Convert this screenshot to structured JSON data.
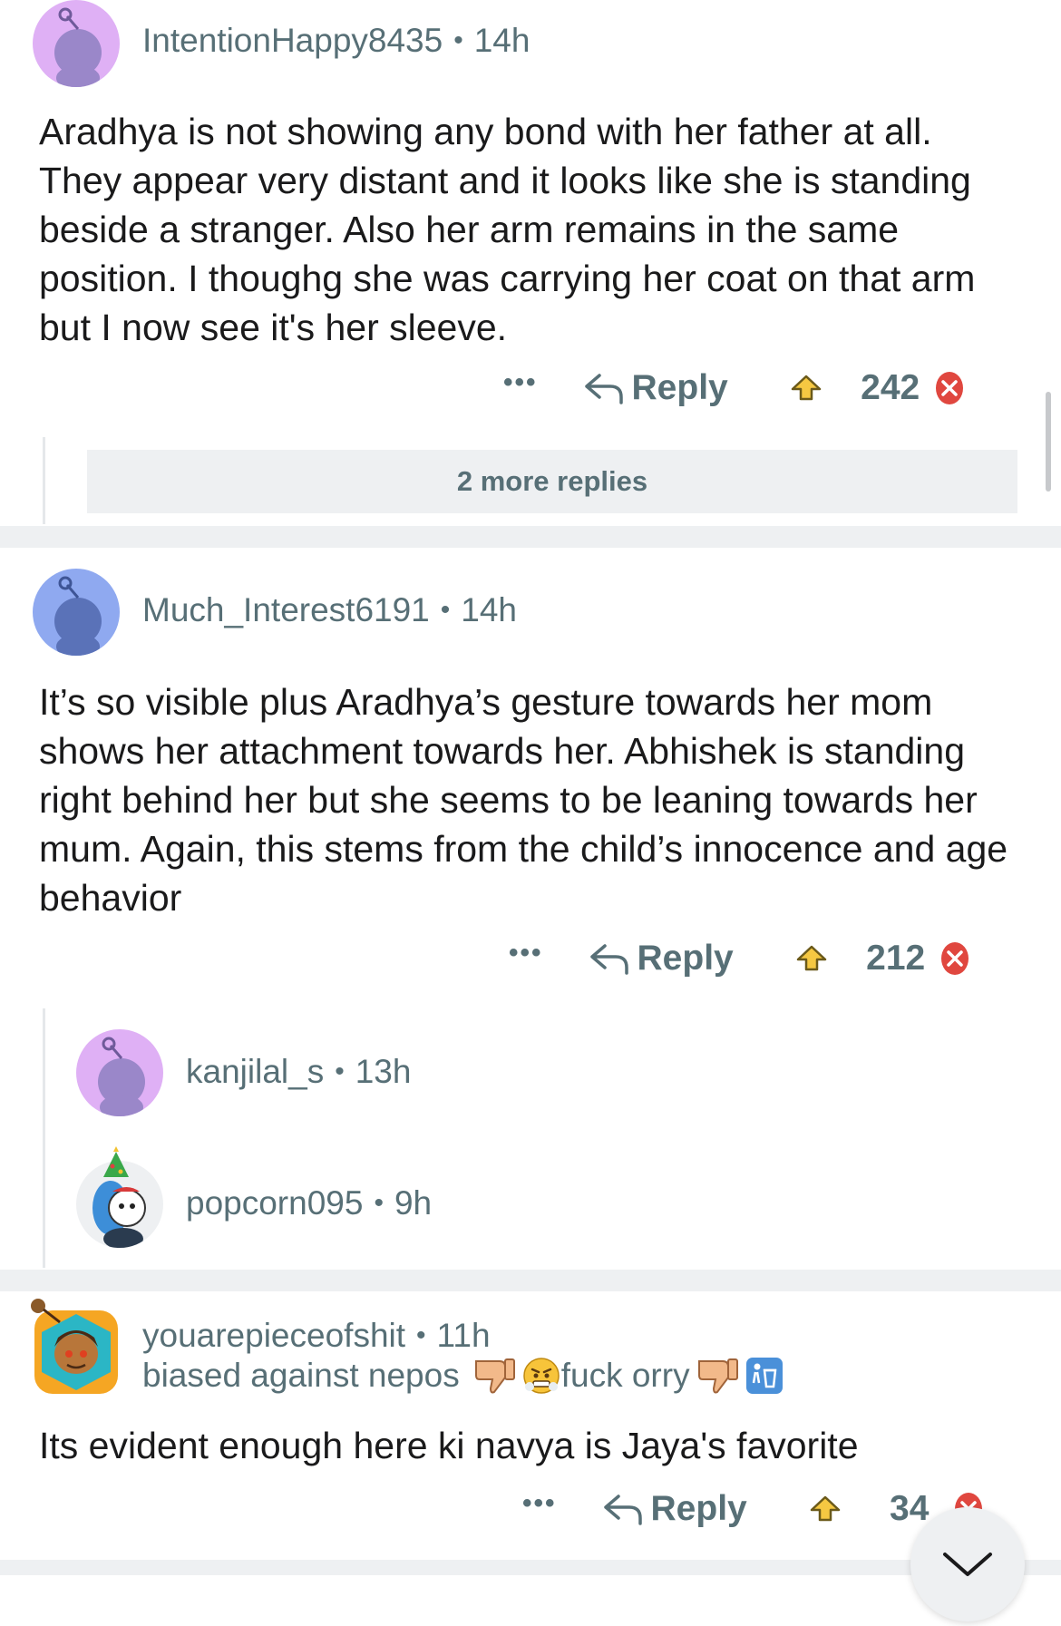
{
  "comments": [
    {
      "username": "IntentionHappy8435",
      "time": "14h",
      "body": "Aradhya is not showing any bond with her father at all. They appear very distant and it looks like she is standing beside a stranger. Also her arm remains in the same position. I thoughg she was carrying her coat on that arm but I now see it's her sleeve.",
      "reply_label": "Reply",
      "score": "242",
      "more_replies": "2 more replies"
    },
    {
      "username": "Much_Interest6191",
      "time": "14h",
      "body": "It’s so visible plus Aradhya’s gesture towards her mom shows her attachment towards her. Abhishek is standing right behind her but she seems to be leaning towards her mum. Again, this stems from the child’s innocence and age behavior",
      "reply_label": "Reply",
      "score": "212",
      "replies": [
        {
          "username": "kanjilal_s",
          "time": "13h"
        },
        {
          "username": "popcorn095",
          "time": "9h"
        }
      ]
    },
    {
      "username": "youarepieceofshit",
      "time": "11h",
      "flair_part1": "biased against nepos",
      "flair_part2": "fuck orry",
      "body": "Its evident enough here ki navya is Jaya's favorite",
      "reply_label": "Reply",
      "score": "34"
    }
  ],
  "more_glyph": "•••",
  "icons": {
    "avatar": "snoo-avatar-icon",
    "reply": "reply-arrow-icon",
    "upvote": "upvote-award-icon",
    "downvote": "downvote-x-icon",
    "thumbs_down": "thumbs-down-icon",
    "angry": "angry-face-icon",
    "trash": "trash-icon",
    "collapse": "chevron-down-icon"
  },
  "colors": {
    "accent_red": "#e0473f",
    "meta_gray": "#576f76",
    "avatar_purple": "#e3a6f7",
    "avatar_blue": "#8fa9f0"
  }
}
